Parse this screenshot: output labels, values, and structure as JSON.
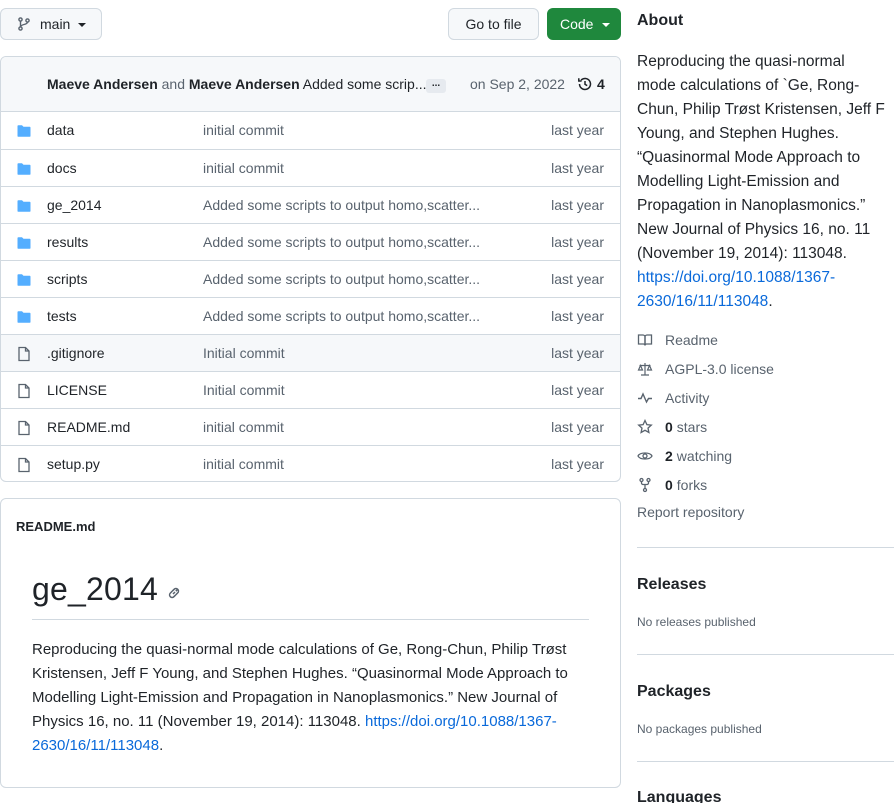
{
  "branch": {
    "label": "main",
    "icon": "git-branch-icon"
  },
  "actions": {
    "goto_file": "Go to file",
    "code": "Code"
  },
  "commit": {
    "author1": "Maeve Andersen",
    "and": "and",
    "author2": "Maeve Andersen",
    "message": "Added some scrip...",
    "more": "...",
    "date": "on Sep 2, 2022",
    "count": "4"
  },
  "files": [
    {
      "name": "data",
      "type": "folder",
      "message": "initial commit",
      "age": "last year"
    },
    {
      "name": "docs",
      "type": "folder",
      "message": "initial commit",
      "age": "last year"
    },
    {
      "name": "ge_2014",
      "type": "folder",
      "message": "Added some scripts to output homo,scatter...",
      "age": "last year"
    },
    {
      "name": "results",
      "type": "folder",
      "message": "Added some scripts to output homo,scatter...",
      "age": "last year"
    },
    {
      "name": "scripts",
      "type": "folder",
      "message": "Added some scripts to output homo,scatter...",
      "age": "last year"
    },
    {
      "name": "tests",
      "type": "folder",
      "message": "Added some scripts to output homo,scatter...",
      "age": "last year"
    },
    {
      "name": ".gitignore",
      "type": "file",
      "message": "Initial commit",
      "age": "last year"
    },
    {
      "name": "LICENSE",
      "type": "file",
      "message": "Initial commit",
      "age": "last year"
    },
    {
      "name": "README.md",
      "type": "file",
      "message": "initial commit",
      "age": "last year"
    },
    {
      "name": "setup.py",
      "type": "file",
      "message": "initial commit",
      "age": "last year"
    }
  ],
  "readme": {
    "header": "README.md",
    "title": "ge_2014",
    "body": "Reproducing the quasi-normal mode calculations of Ge, Rong-Chun, Philip Trøst Kristensen, Jeff F Young, and Stephen Hughes. “Quasinormal Mode Approach to Modelling Light-Emission and Propagation in Nanoplasmonics.” New Journal of Physics 16, no. 11 (November 19, 2014): 113048.",
    "link": "https://doi.org/10.1088/1367-2630/16/11/113048",
    "link_suffix": "."
  },
  "about": {
    "heading": "About",
    "description": "Reproducing the quasi-normal mode calculations of `Ge, Rong-Chun, Philip Trøst Kristensen, Jeff F Young, and Stephen Hughes. “Quasinormal Mode Approach to Modelling Light-Emission and Propagation in Nanoplasmonics.” New Journal of Physics 16, no. 11 (November 19, 2014): 113048.",
    "link": "https://doi.org/10.1088/1367-2630/16/11/113048",
    "link_suffix": ".",
    "readme": "Readme",
    "license": "AGPL-3.0 license",
    "activity": "Activity",
    "stars_count": "0",
    "stars_label": "stars",
    "watching_count": "2",
    "watching_label": "watching",
    "forks_count": "0",
    "forks_label": "forks",
    "report": "Report repository"
  },
  "releases": {
    "heading": "Releases",
    "none": "No releases published"
  },
  "packages": {
    "heading": "Packages",
    "none": "No packages published"
  },
  "languages": {
    "heading": "Languages"
  },
  "colors": {
    "accent": "#0969da",
    "folder": "#54aeff",
    "green": "#1f883d",
    "muted": "#59636e"
  }
}
